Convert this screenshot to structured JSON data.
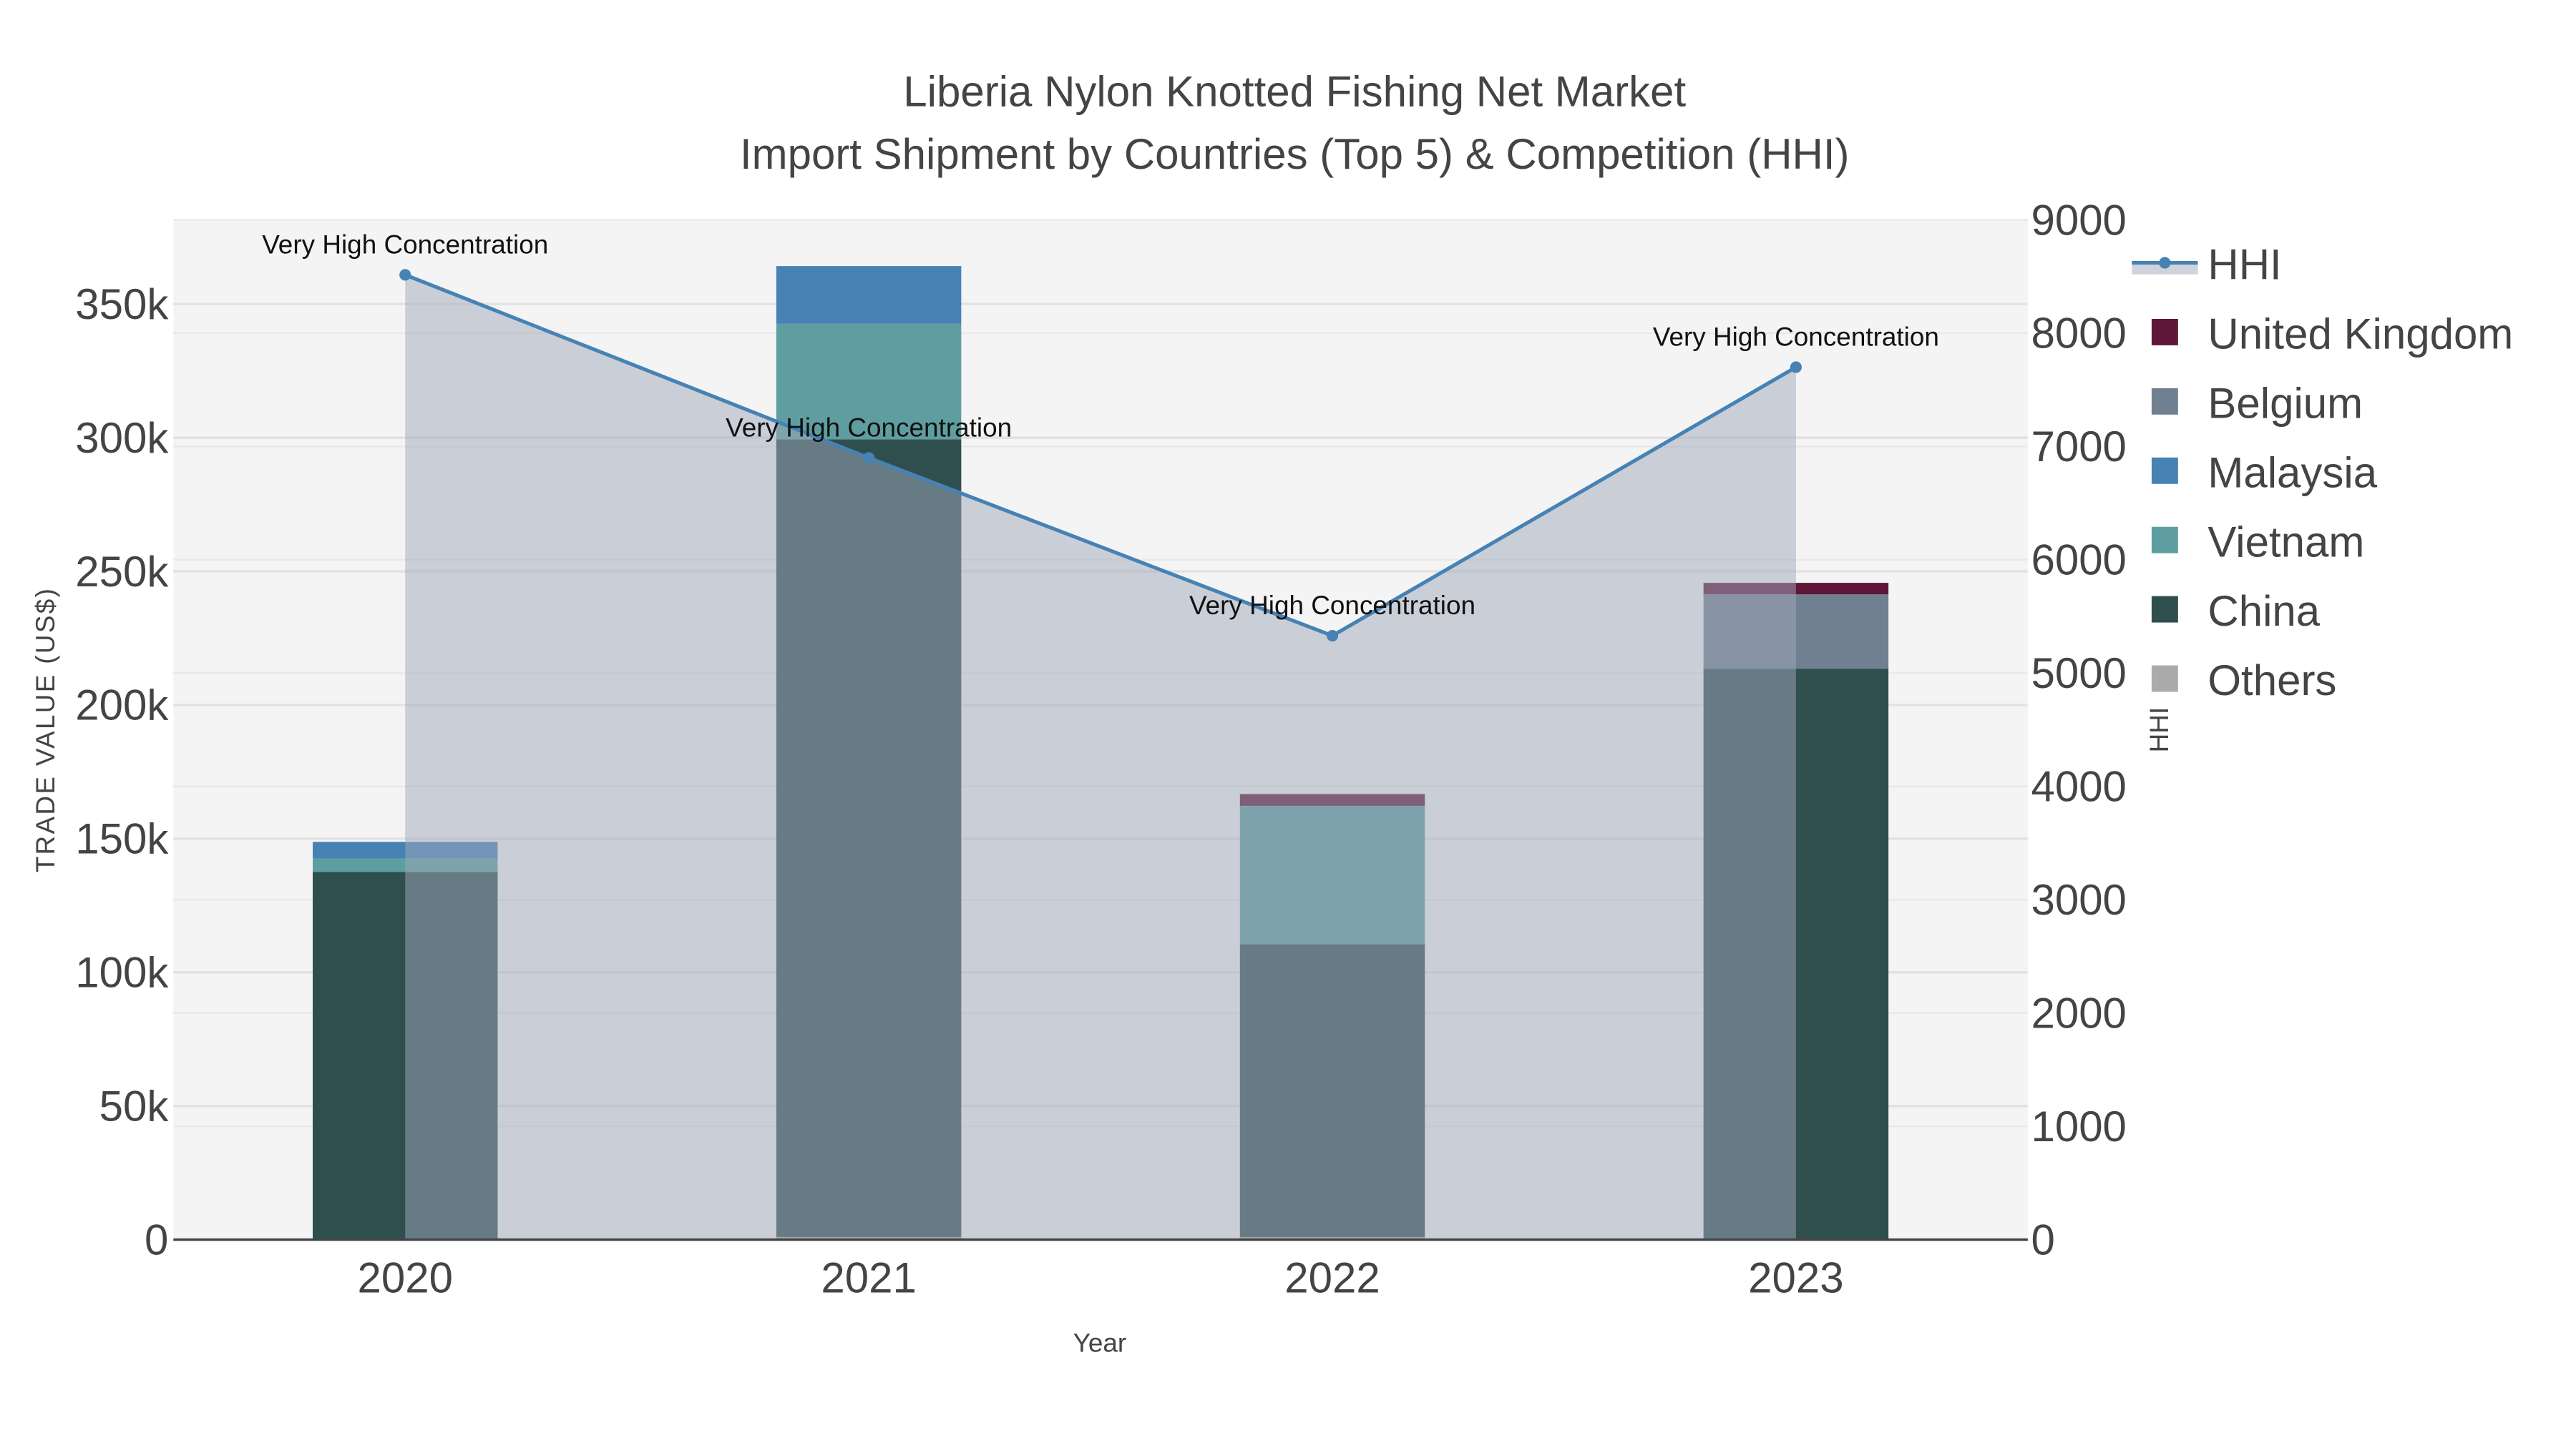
{
  "chart_data": {
    "type": "bar",
    "stacked": true,
    "title": "Liberia Nylon Knotted Fishing Net Market",
    "subtitle": "Import Shipment by Countries (Top 5) & Competition (HHI)",
    "xlabel": "Year",
    "ylabel": "TRADE VALUE (US$)",
    "y2label": "HHI",
    "categories": [
      "2020",
      "2021",
      "2022",
      "2023"
    ],
    "ylim": [
      0,
      378000
    ],
    "y2lim": [
      0,
      9000
    ],
    "yticks": [
      0,
      50000,
      100000,
      150000,
      200000,
      250000,
      300000,
      350000
    ],
    "ytick_labels": [
      "0",
      "50k",
      "100k",
      "150k",
      "200k",
      "250k",
      "300k",
      "350k"
    ],
    "y2ticks": [
      0,
      1000,
      2000,
      3000,
      4000,
      5000,
      6000,
      7000,
      8000,
      9000
    ],
    "y2tick_labels": [
      "0",
      "1000",
      "2000",
      "3000",
      "4000",
      "5000",
      "6000",
      "7000",
      "8000",
      "9000"
    ],
    "series": [
      {
        "name": "Others",
        "color": "#aaaaaa",
        "values": [
          0,
          1000,
          1000,
          0
        ]
      },
      {
        "name": "China",
        "color": "#2f4f4f",
        "values": [
          137600,
          298400,
          109500,
          213600
        ]
      },
      {
        "name": "Vietnam",
        "color": "#5f9ea0",
        "values": [
          5000,
          43200,
          51800,
          0
        ]
      },
      {
        "name": "Malaysia",
        "color": "#4682b4",
        "values": [
          6200,
          21600,
          0,
          0
        ]
      },
      {
        "name": "Belgium",
        "color": "#708090",
        "values": [
          0,
          0,
          0,
          27800
        ]
      },
      {
        "name": "United Kingdom",
        "color": "#5e1739",
        "values": [
          0,
          0,
          4400,
          4300
        ]
      }
    ],
    "hhi": {
      "name": "HHI",
      "color": "#4682b4",
      "values": [
        8515,
        6900,
        5330,
        7700
      ]
    },
    "annotations": [
      "Very High Concentration",
      "Very High Concentration",
      "Very High Concentration",
      "Very High Concentration"
    ],
    "legend_order": [
      "HHI",
      "United Kingdom",
      "Belgium",
      "Malaysia",
      "Vietnam",
      "China",
      "Others"
    ],
    "legend_position": "right",
    "grid": true
  }
}
